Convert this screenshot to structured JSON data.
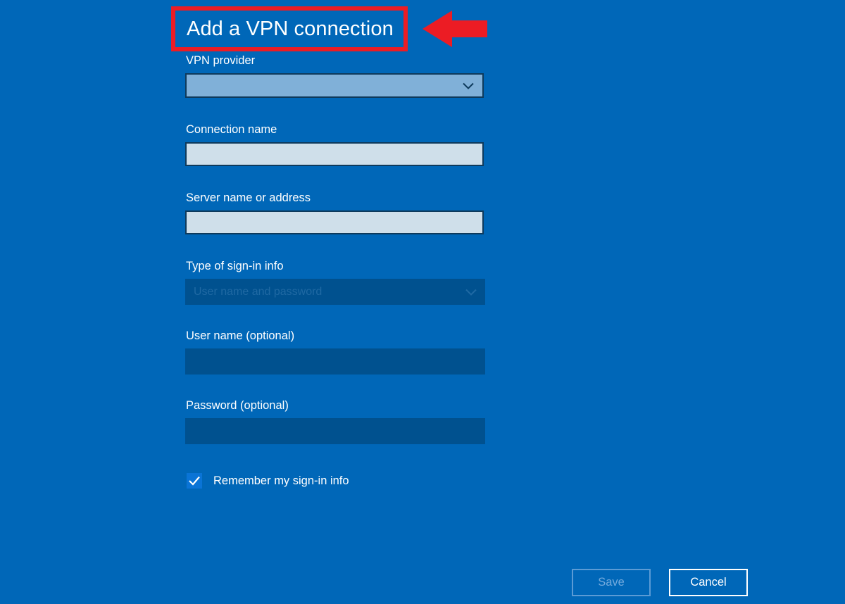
{
  "page": {
    "title": "Add a VPN connection",
    "background_color": "#0067b8"
  },
  "annotation": {
    "highlight_color": "#ec1c24",
    "arrow_icon": "arrow-left-icon",
    "target": "Add a VPN connection"
  },
  "form": {
    "fields": [
      {
        "label": "VPN provider",
        "type": "dropdown",
        "value": "",
        "disabled": false
      },
      {
        "label": "Connection name",
        "type": "text",
        "value": "",
        "placeholder": "",
        "disabled": false
      },
      {
        "label": "Server name or address",
        "type": "text",
        "value": "",
        "placeholder": "",
        "disabled": false
      },
      {
        "label": "Type of sign-in info",
        "type": "dropdown",
        "value": "User name and password",
        "disabled": true
      },
      {
        "label": "User name (optional)",
        "type": "text",
        "value": "",
        "placeholder": "",
        "disabled": true
      },
      {
        "label": "Password (optional)",
        "type": "text",
        "value": "",
        "placeholder": "",
        "disabled": true
      }
    ],
    "remember": {
      "label": "Remember my sign-in info",
      "checked": true,
      "fill_color": "#0a74d6"
    }
  },
  "footer": {
    "save_label": "Save",
    "save_disabled": true,
    "cancel_label": "Cancel",
    "cancel_disabled": false
  }
}
